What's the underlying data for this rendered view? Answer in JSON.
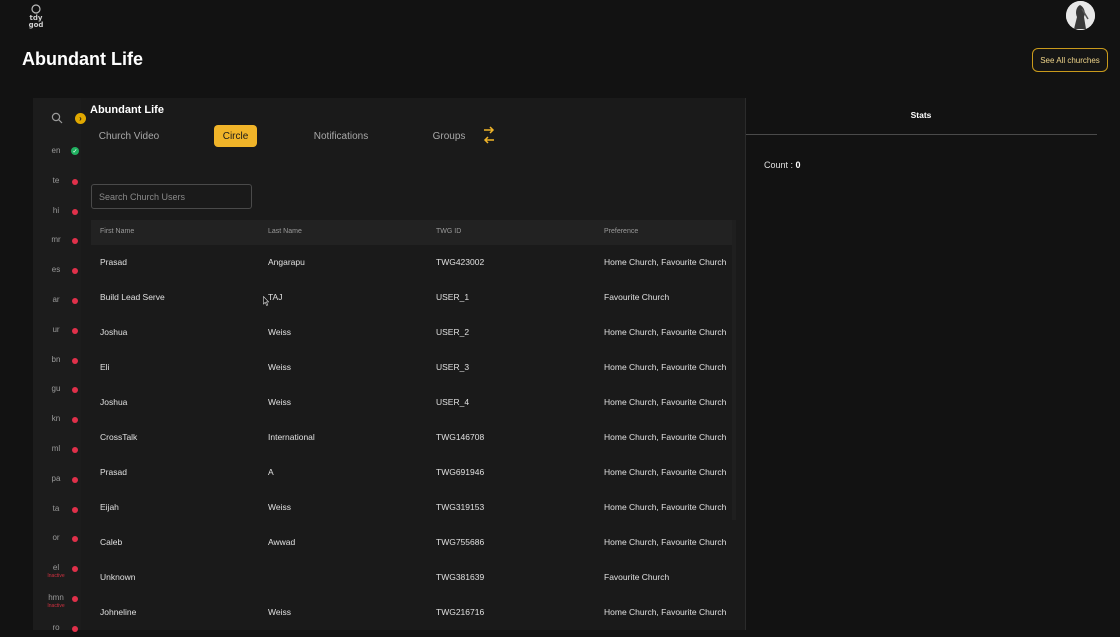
{
  "header": {
    "logo_text": "today god",
    "page_title": "Abundant Life",
    "see_all_label": "See All churches"
  },
  "languages": [
    {
      "code": "en",
      "status": "active"
    },
    {
      "code": "te",
      "status": "inactive"
    },
    {
      "code": "hi",
      "status": "inactive"
    },
    {
      "code": "mr",
      "status": "inactive"
    },
    {
      "code": "es",
      "status": "inactive"
    },
    {
      "code": "ar",
      "status": "inactive"
    },
    {
      "code": "ur",
      "status": "inactive"
    },
    {
      "code": "bn",
      "status": "inactive"
    },
    {
      "code": "gu",
      "status": "inactive"
    },
    {
      "code": "kn",
      "status": "inactive"
    },
    {
      "code": "ml",
      "status": "inactive"
    },
    {
      "code": "pa",
      "status": "inactive"
    },
    {
      "code": "ta",
      "status": "inactive"
    },
    {
      "code": "or",
      "status": "inactive"
    },
    {
      "code": "el",
      "status": "inactive",
      "sub": "Inactive"
    },
    {
      "code": "hmn",
      "status": "inactive",
      "sub": "Inactive"
    },
    {
      "code": "ro",
      "status": "inactive"
    }
  ],
  "panel": {
    "title": "Abundant Life",
    "tabs": [
      {
        "label": "Church Video",
        "active": false
      },
      {
        "label": "Circle",
        "active": true
      },
      {
        "label": "Notifications",
        "active": false
      },
      {
        "label": "Groups",
        "active": false
      }
    ],
    "search_placeholder": "Search Church Users"
  },
  "table": {
    "columns": [
      "First Name",
      "Last Name",
      "TWG ID",
      "Preference"
    ],
    "rows": [
      [
        "Prasad",
        "Angarapu",
        "TWG423002",
        "Home Church, Favourite Church"
      ],
      [
        "Build Lead Serve",
        "TAJ",
        "USER_1",
        "Favourite Church"
      ],
      [
        "Joshua",
        "Weiss",
        "USER_2",
        "Home Church, Favourite Church"
      ],
      [
        "Eli",
        "Weiss",
        "USER_3",
        "Home Church, Favourite Church"
      ],
      [
        "Joshua",
        "Weiss",
        "USER_4",
        "Home Church, Favourite Church"
      ],
      [
        "CrossTalk",
        "International",
        "TWG146708",
        "Home Church, Favourite Church"
      ],
      [
        "Prasad",
        "A",
        "TWG691946",
        "Home Church, Favourite Church"
      ],
      [
        "Eijah",
        "Weiss",
        "TWG319153",
        "Home Church, Favourite Church"
      ],
      [
        "Caleb",
        "Awwad",
        "TWG755686",
        "Home Church, Favourite Church"
      ],
      [
        "Unknown",
        "",
        "TWG381639",
        "Favourite Church"
      ],
      [
        "Johneline",
        "Weiss",
        "TWG216716",
        "Home Church, Favourite Church"
      ]
    ]
  },
  "stats": {
    "title": "Stats",
    "count_label": "Count : ",
    "count_value": "0"
  },
  "colors": {
    "accent": "#f0b429",
    "active_dot": "#20b060",
    "inactive_dot": "#e0304a"
  },
  "icons": {
    "search": "search-icon",
    "expand": "chevron-right-icon",
    "swap": "swap-arrows-icon",
    "cursor": "mouse-cursor-icon"
  }
}
